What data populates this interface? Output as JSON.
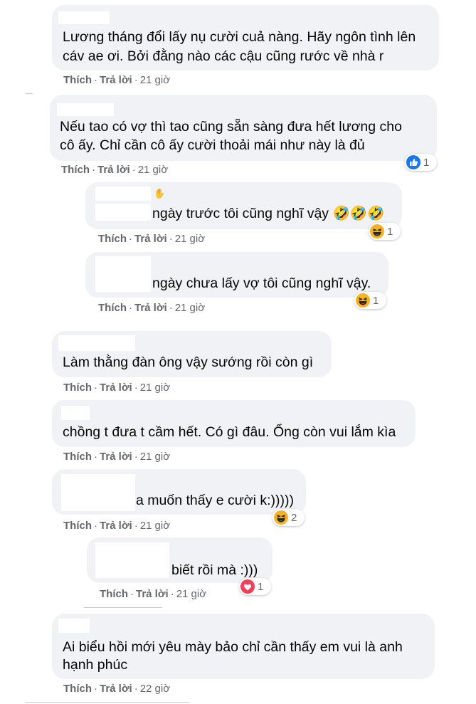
{
  "colors": {
    "bubble": "#f0f2f5",
    "meta": "#65676b",
    "like_blue": "#1877f2",
    "haha_yellow": "#f7b125",
    "love_red": "#f33e58"
  },
  "actions": {
    "like": "Thích",
    "reply": "Trả lời",
    "dot": "·"
  },
  "comments": [
    {
      "lines": [
        "Lương tháng đổi lấy nụ cười cuả nàng. Hãy ngôn tình lên",
        "cáv ae ơi. Bởi đằng nào các cậu cũng rước về nhà r"
      ],
      "time": "21 giờ"
    },
    {
      "lines": [
        "Nếu tao có vợ thì tao cũng sẵn sàng đưa hết lương cho",
        "cô ấy. Chỉ cần cô ấy cười thoải mái như này là đủ"
      ],
      "time": "21 giờ",
      "reaction": {
        "icon": "like-icon",
        "count": "1"
      }
    },
    {
      "lines": [
        "ngày trước tôi cũng nghĩ vậy 🤣🤣🤣"
      ],
      "time": "21 giờ",
      "reaction": {
        "icon": "haha-icon",
        "count": "1"
      }
    },
    {
      "lines": [
        "ngày chưa lấy vợ tôi cũng nghĩ vậy."
      ],
      "time": "21 giờ",
      "reaction": {
        "icon": "haha-icon",
        "count": "1"
      }
    },
    {
      "lines": [
        "Làm thằng đàn ông vậy sướng rồi còn gì"
      ],
      "time": "21 giờ"
    },
    {
      "lines": [
        "chồng t đưa t cầm hết. Có gì đâu. Ổng còn vui lắm kìa"
      ],
      "time": "21 giờ"
    },
    {
      "lines": [
        "a muốn thấy e cười k:)))))"
      ],
      "time": "21 giờ",
      "reaction": {
        "icon": "haha-icon",
        "count": "2"
      }
    },
    {
      "lines": [
        "biết rồi mà :)))"
      ],
      "time": "21 giờ",
      "reaction": {
        "icon": "love-icon",
        "count": "1"
      }
    },
    {
      "lines": [
        "Ai biểu hồi mới yêu mày bảo chỉ cần thấy em vui là anh",
        "hạnh phúc"
      ],
      "time": "22 giờ"
    }
  ]
}
